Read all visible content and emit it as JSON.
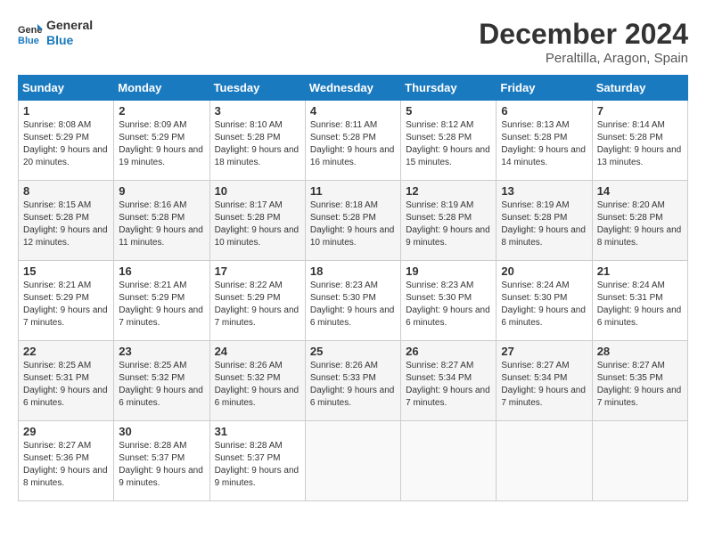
{
  "header": {
    "logo_line1": "General",
    "logo_line2": "Blue",
    "month": "December 2024",
    "location": "Peraltilla, Aragon, Spain"
  },
  "weekdays": [
    "Sunday",
    "Monday",
    "Tuesday",
    "Wednesday",
    "Thursday",
    "Friday",
    "Saturday"
  ],
  "weeks": [
    [
      {
        "day": "1",
        "sunrise": "Sunrise: 8:08 AM",
        "sunset": "Sunset: 5:29 PM",
        "daylight": "Daylight: 9 hours and 20 minutes."
      },
      {
        "day": "2",
        "sunrise": "Sunrise: 8:09 AM",
        "sunset": "Sunset: 5:29 PM",
        "daylight": "Daylight: 9 hours and 19 minutes."
      },
      {
        "day": "3",
        "sunrise": "Sunrise: 8:10 AM",
        "sunset": "Sunset: 5:28 PM",
        "daylight": "Daylight: 9 hours and 18 minutes."
      },
      {
        "day": "4",
        "sunrise": "Sunrise: 8:11 AM",
        "sunset": "Sunset: 5:28 PM",
        "daylight": "Daylight: 9 hours and 16 minutes."
      },
      {
        "day": "5",
        "sunrise": "Sunrise: 8:12 AM",
        "sunset": "Sunset: 5:28 PM",
        "daylight": "Daylight: 9 hours and 15 minutes."
      },
      {
        "day": "6",
        "sunrise": "Sunrise: 8:13 AM",
        "sunset": "Sunset: 5:28 PM",
        "daylight": "Daylight: 9 hours and 14 minutes."
      },
      {
        "day": "7",
        "sunrise": "Sunrise: 8:14 AM",
        "sunset": "Sunset: 5:28 PM",
        "daylight": "Daylight: 9 hours and 13 minutes."
      }
    ],
    [
      {
        "day": "8",
        "sunrise": "Sunrise: 8:15 AM",
        "sunset": "Sunset: 5:28 PM",
        "daylight": "Daylight: 9 hours and 12 minutes."
      },
      {
        "day": "9",
        "sunrise": "Sunrise: 8:16 AM",
        "sunset": "Sunset: 5:28 PM",
        "daylight": "Daylight: 9 hours and 11 minutes."
      },
      {
        "day": "10",
        "sunrise": "Sunrise: 8:17 AM",
        "sunset": "Sunset: 5:28 PM",
        "daylight": "Daylight: 9 hours and 10 minutes."
      },
      {
        "day": "11",
        "sunrise": "Sunrise: 8:18 AM",
        "sunset": "Sunset: 5:28 PM",
        "daylight": "Daylight: 9 hours and 10 minutes."
      },
      {
        "day": "12",
        "sunrise": "Sunrise: 8:19 AM",
        "sunset": "Sunset: 5:28 PM",
        "daylight": "Daylight: 9 hours and 9 minutes."
      },
      {
        "day": "13",
        "sunrise": "Sunrise: 8:19 AM",
        "sunset": "Sunset: 5:28 PM",
        "daylight": "Daylight: 9 hours and 8 minutes."
      },
      {
        "day": "14",
        "sunrise": "Sunrise: 8:20 AM",
        "sunset": "Sunset: 5:28 PM",
        "daylight": "Daylight: 9 hours and 8 minutes."
      }
    ],
    [
      {
        "day": "15",
        "sunrise": "Sunrise: 8:21 AM",
        "sunset": "Sunset: 5:29 PM",
        "daylight": "Daylight: 9 hours and 7 minutes."
      },
      {
        "day": "16",
        "sunrise": "Sunrise: 8:21 AM",
        "sunset": "Sunset: 5:29 PM",
        "daylight": "Daylight: 9 hours and 7 minutes."
      },
      {
        "day": "17",
        "sunrise": "Sunrise: 8:22 AM",
        "sunset": "Sunset: 5:29 PM",
        "daylight": "Daylight: 9 hours and 7 minutes."
      },
      {
        "day": "18",
        "sunrise": "Sunrise: 8:23 AM",
        "sunset": "Sunset: 5:30 PM",
        "daylight": "Daylight: 9 hours and 6 minutes."
      },
      {
        "day": "19",
        "sunrise": "Sunrise: 8:23 AM",
        "sunset": "Sunset: 5:30 PM",
        "daylight": "Daylight: 9 hours and 6 minutes."
      },
      {
        "day": "20",
        "sunrise": "Sunrise: 8:24 AM",
        "sunset": "Sunset: 5:30 PM",
        "daylight": "Daylight: 9 hours and 6 minutes."
      },
      {
        "day": "21",
        "sunrise": "Sunrise: 8:24 AM",
        "sunset": "Sunset: 5:31 PM",
        "daylight": "Daylight: 9 hours and 6 minutes."
      }
    ],
    [
      {
        "day": "22",
        "sunrise": "Sunrise: 8:25 AM",
        "sunset": "Sunset: 5:31 PM",
        "daylight": "Daylight: 9 hours and 6 minutes."
      },
      {
        "day": "23",
        "sunrise": "Sunrise: 8:25 AM",
        "sunset": "Sunset: 5:32 PM",
        "daylight": "Daylight: 9 hours and 6 minutes."
      },
      {
        "day": "24",
        "sunrise": "Sunrise: 8:26 AM",
        "sunset": "Sunset: 5:32 PM",
        "daylight": "Daylight: 9 hours and 6 minutes."
      },
      {
        "day": "25",
        "sunrise": "Sunrise: 8:26 AM",
        "sunset": "Sunset: 5:33 PM",
        "daylight": "Daylight: 9 hours and 6 minutes."
      },
      {
        "day": "26",
        "sunrise": "Sunrise: 8:27 AM",
        "sunset": "Sunset: 5:34 PM",
        "daylight": "Daylight: 9 hours and 7 minutes."
      },
      {
        "day": "27",
        "sunrise": "Sunrise: 8:27 AM",
        "sunset": "Sunset: 5:34 PM",
        "daylight": "Daylight: 9 hours and 7 minutes."
      },
      {
        "day": "28",
        "sunrise": "Sunrise: 8:27 AM",
        "sunset": "Sunset: 5:35 PM",
        "daylight": "Daylight: 9 hours and 7 minutes."
      }
    ],
    [
      {
        "day": "29",
        "sunrise": "Sunrise: 8:27 AM",
        "sunset": "Sunset: 5:36 PM",
        "daylight": "Daylight: 9 hours and 8 minutes."
      },
      {
        "day": "30",
        "sunrise": "Sunrise: 8:28 AM",
        "sunset": "Sunset: 5:37 PM",
        "daylight": "Daylight: 9 hours and 9 minutes."
      },
      {
        "day": "31",
        "sunrise": "Sunrise: 8:28 AM",
        "sunset": "Sunset: 5:37 PM",
        "daylight": "Daylight: 9 hours and 9 minutes."
      },
      null,
      null,
      null,
      null
    ]
  ]
}
